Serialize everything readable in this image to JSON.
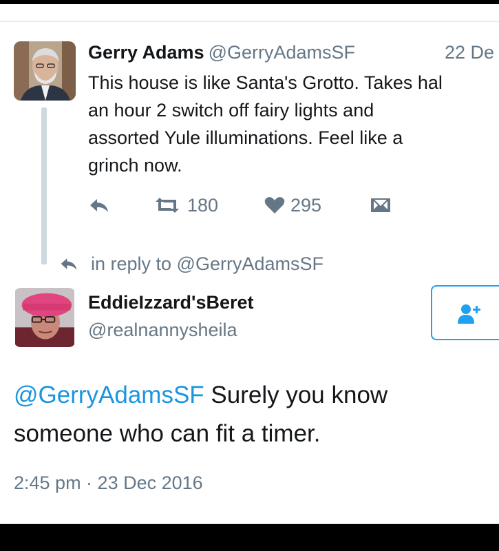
{
  "original_tweet": {
    "name": "Gerry Adams",
    "handle": "@GerryAdamsSF",
    "date": "22 De",
    "lines": [
      "This house is like Santa's Grotto. Takes hal",
      "an hour 2 switch off fairy lights and",
      "assorted Yule illuminations. Feel like a",
      "grinch now."
    ],
    "retweets": "180",
    "likes": "295"
  },
  "reply_context": {
    "text": "in reply to @GerryAdamsSF"
  },
  "reply_tweet": {
    "name": "EddieIzzard'sBeret",
    "handle": "@realnannysheila",
    "mention": "@GerryAdamsSF",
    "line1_rest": " Surely you know",
    "line2": "someone who can fit a timer.",
    "timestamp": "2:45 pm · 23 Dec 2016"
  },
  "colors": {
    "accent": "#1da1f2",
    "mention": "#1b95e0",
    "secondary_text": "#657786",
    "primary_text": "#14171a",
    "background": "#ffffff"
  },
  "icons": {
    "reply": "reply-icon",
    "retweet": "retweet-icon",
    "like": "heart-icon",
    "message": "envelope-icon",
    "follow": "add-user-icon"
  }
}
